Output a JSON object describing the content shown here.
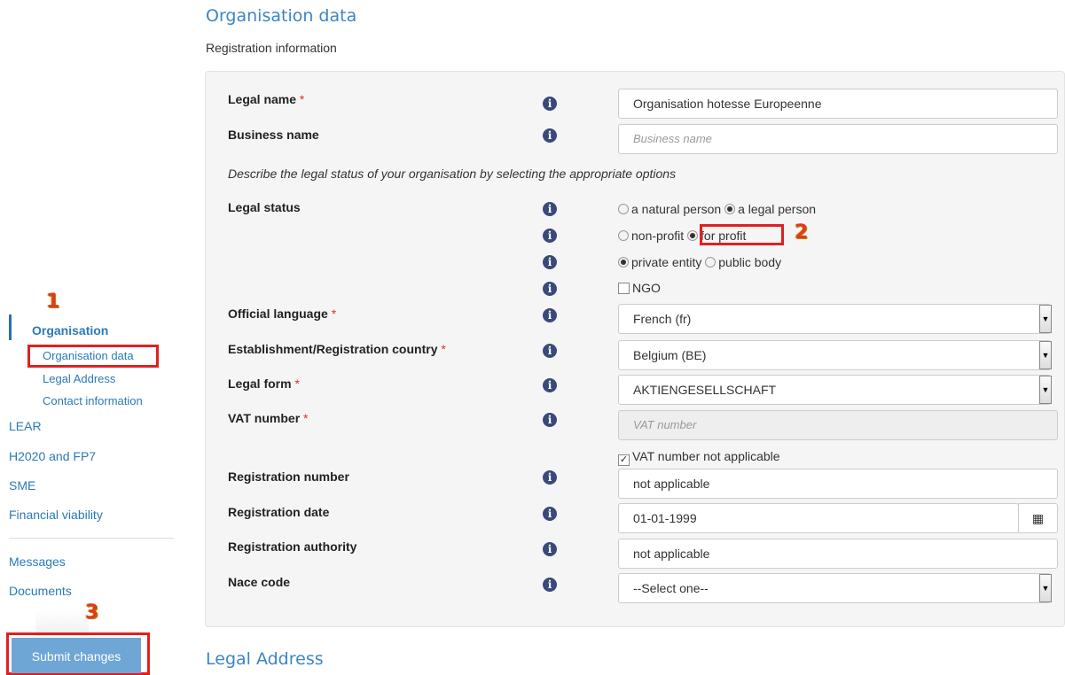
{
  "annotations": {
    "one": "1",
    "two": "2",
    "three": "3"
  },
  "sidebar": {
    "section": "Organisation",
    "sub_items": [
      "Organisation data",
      "Legal Address",
      "Contact information"
    ],
    "items": [
      "LEAR",
      "H2020 and FP7",
      "SME",
      "Financial viability"
    ],
    "items2": [
      "Messages",
      "Documents"
    ],
    "submit_label": "Submit changes"
  },
  "main": {
    "title": "Organisation data",
    "subtitle": "Registration information",
    "next_section": "Legal Address",
    "hint": "Describe the legal status of your organisation by selecting the appropriate options",
    "required_mark": "*",
    "info_glyph": "i",
    "fields": {
      "legal_name": {
        "label": "Legal name",
        "value": "Organisation hotesse Europeenne"
      },
      "business_name": {
        "label": "Business name",
        "placeholder": "Business name"
      },
      "legal_status": {
        "label": "Legal status",
        "natural": "a natural person",
        "legal": "a legal person",
        "nonprofit": "non-profit",
        "forprofit": "for profit",
        "private": "private entity",
        "public": "public body",
        "ngo": "NGO"
      },
      "official_language": {
        "label": "Official language",
        "value": "French (fr)"
      },
      "country": {
        "label": "Establishment/Registration country",
        "value": "Belgium (BE)"
      },
      "legal_form": {
        "label": "Legal form",
        "value": "AKTIENGESELLSCHAFT"
      },
      "vat": {
        "label": "VAT number",
        "placeholder": "VAT number",
        "not_applicable": "VAT number not applicable"
      },
      "registration_number": {
        "label": "Registration number",
        "value": "not applicable"
      },
      "registration_date": {
        "label": "Registration date",
        "value": "01-01-1999"
      },
      "registration_authority": {
        "label": "Registration authority",
        "value": "not applicable"
      },
      "nace": {
        "label": "Nace code",
        "value": "--Select one--"
      }
    }
  },
  "colors": {
    "accent": "#3d85c6",
    "link": "#2a7ab8",
    "required": "#d9302c",
    "highlight": "#e02020",
    "button": "#6ea6d6"
  }
}
